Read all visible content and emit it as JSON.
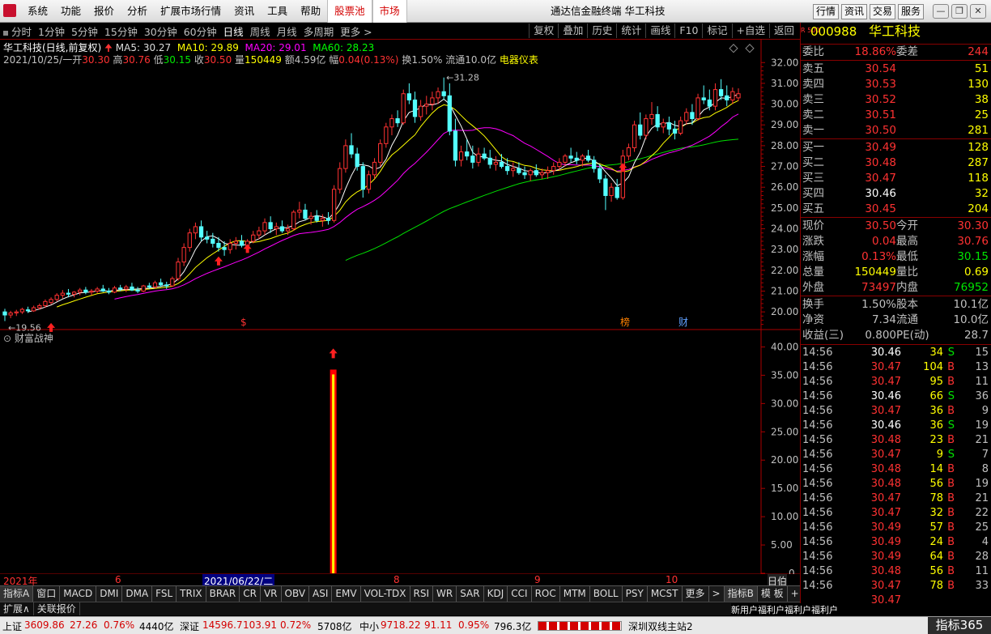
{
  "menu": {
    "items": [
      "系统",
      "功能",
      "报价",
      "分析",
      "扩展市场行情",
      "资讯",
      "工具",
      "帮助"
    ],
    "red_items": [
      "股票池",
      "市场"
    ],
    "app_title": "通达信金融终端  华工科技",
    "right_buttons": [
      "行情",
      "资讯",
      "交易",
      "服务"
    ]
  },
  "period_bar": {
    "items": [
      "分时",
      "1分钟",
      "5分钟",
      "15分钟",
      "30分钟",
      "60分钟",
      "日线",
      "周线",
      "月线",
      "多周期",
      "更多 >"
    ],
    "active": "日线",
    "tools": [
      "复权",
      "叠加",
      "历史",
      "统计",
      "画线",
      "F10",
      "标记",
      "+自选",
      "返回"
    ]
  },
  "chart_header": {
    "name": "华工科技(日线,前复权)",
    "ma5": "MA5: 30.27",
    "ma10": "MA10: 29.89",
    "ma20": "MA20: 29.01",
    "ma60": "MA60: 28.23"
  },
  "day_info": {
    "date": "2021/10/25/一",
    "open_l": "开",
    "open": "30.30",
    "high_l": "高",
    "high": "30.76",
    "low_l": "低",
    "low": "30.15",
    "close_l": "收",
    "close": "30.50",
    "vol_l": "量",
    "vol": "150449",
    "amt_l": "额",
    "amt": "4.59亿",
    "chg_l": "幅",
    "chg": "0.04(0.13%)",
    "turn": "换1.50%",
    "float": "流通10.0亿",
    "sector": "电器仪表"
  },
  "indicator": {
    "name": "财富战神"
  },
  "x_axis": {
    "labels": [
      "2021年",
      "6",
      "2021/06/22/二",
      "8",
      "9",
      "10"
    ],
    "right": "日伯"
  },
  "bottom_tabs": [
    "指标A",
    "窗口",
    "MACD",
    "DMI",
    "DMA",
    "FSL",
    "TRIX",
    "BRAR",
    "CR",
    "VR",
    "OBV",
    "ASI",
    "EMV",
    "VOL-TDX",
    "RSI",
    "WR",
    "SAR",
    "KDJ",
    "CCI",
    "ROC",
    "MTM",
    "BOLL",
    "PSY",
    "MCST",
    "更多",
    ">",
    "指标B",
    "模 板",
    "+"
  ],
  "bottom_tabs2": [
    "扩展∧",
    "关联报价"
  ],
  "status": {
    "sh_l": "上证",
    "sh": "3609.86",
    "sh_chg": "27.26",
    "sh_pct": "0.76%",
    "sh_amt": "4440亿",
    "sz_l": "深证",
    "sz": "14596.7",
    "sz_chg": "103.91",
    "sz_pct": "0.72%",
    "sz_amt": "5708亿",
    "zx_l": "中小",
    "zx": "9718.22",
    "zx_chg": "91.11",
    "zx_pct": "0.95%",
    "zx_amt": "796.3亿",
    "server": "深圳双线主站2",
    "ticker": "新用户福利户福利户福利户",
    "brand": "指标365"
  },
  "quote": {
    "tag": "R 500",
    "code": "000988",
    "name": "华工科技",
    "weibi_l": "委比",
    "weibi": "18.86%",
    "weicha_l": "委差",
    "weicha": "244",
    "asks": [
      {
        "l": "卖五",
        "p": "30.54",
        "v": "51"
      },
      {
        "l": "卖四",
        "p": "30.53",
        "v": "130"
      },
      {
        "l": "卖三",
        "p": "30.52",
        "v": "38"
      },
      {
        "l": "卖二",
        "p": "30.51",
        "v": "25"
      },
      {
        "l": "卖一",
        "p": "30.50",
        "v": "281"
      }
    ],
    "bids": [
      {
        "l": "买一",
        "p": "30.49",
        "v": "128"
      },
      {
        "l": "买二",
        "p": "30.48",
        "v": "287"
      },
      {
        "l": "买三",
        "p": "30.47",
        "v": "118"
      },
      {
        "l": "买四",
        "p": "30.46",
        "v": "32"
      },
      {
        "l": "买五",
        "p": "30.45",
        "v": "204"
      }
    ],
    "stats": [
      [
        "现价",
        "30.50",
        "今开",
        "30.30"
      ],
      [
        "涨跌",
        "0.04",
        "最高",
        "30.76"
      ],
      [
        "涨幅",
        "0.13%",
        "最低",
        "30.15"
      ],
      [
        "总量",
        "150449",
        "量比",
        "0.69"
      ],
      [
        "外盘",
        "73497",
        "内盘",
        "76952"
      ]
    ],
    "fund": [
      [
        "换手",
        "1.50%",
        "股本",
        "10.1亿"
      ],
      [
        "净资",
        "7.34",
        "流通",
        "10.0亿"
      ],
      [
        "收益(三)",
        "0.800",
        "PE(动)",
        "28.7"
      ]
    ],
    "ticks": [
      [
        "14:56",
        "30.46",
        "34",
        "S",
        "15"
      ],
      [
        "14:56",
        "30.47",
        "104",
        "B",
        "13"
      ],
      [
        "14:56",
        "30.47",
        "95",
        "B",
        "11"
      ],
      [
        "14:56",
        "30.46",
        "66",
        "S",
        "36"
      ],
      [
        "14:56",
        "30.47",
        "36",
        "B",
        "9"
      ],
      [
        "14:56",
        "30.46",
        "36",
        "S",
        "19"
      ],
      [
        "14:56",
        "30.48",
        "23",
        "B",
        "21"
      ],
      [
        "14:56",
        "30.47",
        "9",
        "S",
        "7"
      ],
      [
        "14:56",
        "30.48",
        "14",
        "B",
        "8"
      ],
      [
        "14:56",
        "30.48",
        "56",
        "B",
        "19"
      ],
      [
        "14:56",
        "30.47",
        "78",
        "B",
        "21"
      ],
      [
        "14:56",
        "30.47",
        "32",
        "B",
        "22"
      ],
      [
        "14:56",
        "30.49",
        "57",
        "B",
        "25"
      ],
      [
        "14:56",
        "30.49",
        "24",
        "B",
        "4"
      ],
      [
        "14:56",
        "30.49",
        "64",
        "B",
        "28"
      ],
      [
        "14:56",
        "30.48",
        "56",
        "B",
        "11"
      ],
      [
        "14:56",
        "30.47",
        "78",
        "B",
        "33"
      ],
      [
        "",
        "30.47",
        "",
        "",
        ""
      ]
    ]
  },
  "chart_data": {
    "type": "candlestick",
    "y_ticks": [
      "32.00",
      "31.00",
      "30.00",
      "29.00",
      "28.00",
      "27.00",
      "26.00",
      "25.00",
      "24.00",
      "23.00",
      "22.00",
      "21.00",
      "20.00"
    ],
    "sub_y_ticks": [
      "40.00",
      "35.00",
      "30.00",
      "25.00",
      "20.00",
      "15.00",
      "10.00",
      "5.00",
      "0"
    ],
    "y_range": [
      19.5,
      32.4
    ],
    "max_label": "31.28",
    "min_label": "19.56",
    "marks": [
      "$",
      "榜",
      "财"
    ],
    "signal": {
      "value": 36,
      "index": 57
    },
    "ohlc": [
      [
        20.0,
        20.15,
        19.56,
        19.85
      ],
      [
        19.85,
        20.05,
        19.7,
        19.95
      ],
      [
        19.95,
        20.1,
        19.8,
        20.0
      ],
      [
        20.0,
        20.2,
        19.9,
        20.12
      ],
      [
        20.1,
        20.25,
        19.95,
        20.05
      ],
      [
        20.05,
        20.3,
        20.0,
        20.2
      ],
      [
        20.2,
        20.4,
        20.1,
        20.3
      ],
      [
        20.3,
        20.6,
        20.2,
        20.5
      ],
      [
        20.45,
        20.7,
        20.35,
        20.6
      ],
      [
        20.6,
        20.9,
        20.5,
        20.8
      ],
      [
        20.8,
        21.05,
        20.65,
        20.9
      ],
      [
        20.9,
        21.1,
        20.7,
        20.85
      ],
      [
        20.85,
        21.0,
        20.7,
        20.95
      ],
      [
        20.95,
        21.15,
        20.8,
        21.05
      ],
      [
        21.05,
        21.2,
        20.85,
        20.95
      ],
      [
        20.95,
        21.1,
        20.8,
        21.0
      ],
      [
        21.0,
        21.2,
        20.9,
        21.1
      ],
      [
        21.1,
        21.3,
        20.95,
        21.0
      ],
      [
        21.0,
        21.15,
        20.85,
        20.95
      ],
      [
        20.95,
        21.25,
        20.9,
        21.15
      ],
      [
        21.15,
        21.3,
        21.0,
        21.1
      ],
      [
        21.1,
        21.3,
        20.95,
        21.2
      ],
      [
        21.2,
        21.4,
        21.0,
        21.05
      ],
      [
        21.05,
        21.2,
        20.9,
        21.0
      ],
      [
        21.0,
        21.3,
        20.95,
        21.25
      ],
      [
        21.25,
        21.4,
        21.1,
        21.2
      ],
      [
        21.2,
        21.5,
        21.1,
        21.4
      ],
      [
        21.4,
        21.6,
        21.2,
        21.3
      ],
      [
        21.3,
        21.45,
        21.1,
        21.25
      ],
      [
        21.25,
        21.7,
        21.2,
        21.6
      ],
      [
        21.6,
        22.6,
        21.5,
        22.4
      ],
      [
        22.4,
        23.3,
        22.2,
        23.1
      ],
      [
        23.1,
        24.0,
        22.9,
        23.8
      ],
      [
        23.8,
        24.3,
        23.5,
        24.1
      ],
      [
        24.1,
        24.4,
        23.4,
        23.6
      ],
      [
        23.6,
        23.9,
        23.3,
        23.5
      ],
      [
        23.5,
        23.8,
        23.1,
        23.3
      ],
      [
        23.3,
        23.6,
        22.9,
        23.1
      ],
      [
        23.1,
        23.4,
        22.7,
        23.0
      ],
      [
        23.0,
        23.5,
        22.8,
        23.3
      ],
      [
        23.3,
        23.6,
        23.0,
        23.4
      ],
      [
        23.4,
        23.7,
        23.1,
        23.2
      ],
      [
        23.2,
        23.5,
        22.9,
        23.4
      ],
      [
        23.4,
        23.9,
        23.3,
        23.7
      ],
      [
        23.7,
        24.1,
        23.5,
        23.9
      ],
      [
        23.9,
        24.5,
        23.7,
        24.3
      ],
      [
        24.3,
        24.6,
        23.8,
        24.0
      ],
      [
        24.0,
        24.3,
        23.7,
        24.1
      ],
      [
        24.1,
        24.4,
        23.8,
        23.9
      ],
      [
        23.9,
        24.2,
        23.7,
        24.0
      ],
      [
        24.0,
        24.9,
        23.9,
        24.8
      ],
      [
        24.8,
        25.3,
        24.5,
        24.9
      ],
      [
        24.9,
        25.2,
        24.4,
        24.5
      ],
      [
        24.5,
        24.8,
        24.2,
        24.6
      ],
      [
        24.6,
        24.9,
        24.3,
        24.4
      ],
      [
        24.4,
        24.7,
        24.1,
        24.5
      ],
      [
        24.5,
        24.8,
        24.2,
        24.4
      ],
      [
        24.4,
        26.1,
        24.3,
        25.9
      ],
      [
        25.9,
        27.2,
        25.7,
        26.9
      ],
      [
        26.9,
        28.3,
        26.7,
        28.0
      ],
      [
        28.0,
        28.6,
        27.4,
        27.6
      ],
      [
        27.6,
        27.9,
        26.8,
        27.0
      ],
      [
        27.0,
        27.2,
        25.5,
        25.9
      ],
      [
        25.9,
        26.8,
        25.7,
        26.6
      ],
      [
        26.6,
        27.4,
        26.4,
        27.2
      ],
      [
        27.2,
        28.3,
        27.0,
        28.1
      ],
      [
        28.1,
        29.1,
        27.9,
        28.9
      ],
      [
        28.9,
        29.5,
        28.5,
        29.3
      ],
      [
        29.3,
        29.7,
        28.9,
        29.1
      ],
      [
        29.1,
        30.7,
        29.0,
        30.5
      ],
      [
        30.5,
        31.0,
        30.0,
        30.2
      ],
      [
        30.2,
        30.6,
        29.1,
        29.4
      ],
      [
        29.4,
        30.2,
        29.2,
        29.9
      ],
      [
        29.9,
        30.4,
        29.5,
        30.0
      ],
      [
        30.0,
        30.6,
        29.7,
        30.3
      ],
      [
        30.3,
        30.8,
        30.0,
        30.6
      ],
      [
        30.6,
        31.28,
        30.2,
        30.4
      ],
      [
        30.4,
        31.0,
        28.5,
        28.7
      ],
      [
        28.7,
        29.3,
        27.0,
        27.3
      ],
      [
        27.3,
        28.0,
        27.0,
        27.7
      ],
      [
        27.7,
        28.3,
        27.3,
        27.5
      ],
      [
        27.5,
        28.0,
        26.9,
        27.2
      ],
      [
        27.2,
        27.9,
        27.0,
        27.6
      ],
      [
        27.6,
        27.9,
        27.3,
        27.4
      ],
      [
        27.4,
        27.8,
        26.9,
        27.1
      ],
      [
        27.1,
        27.5,
        26.8,
        27.2
      ],
      [
        27.2,
        27.6,
        26.9,
        27.0
      ],
      [
        27.0,
        27.4,
        26.6,
        26.8
      ],
      [
        26.8,
        27.2,
        26.5,
        26.9
      ],
      [
        26.9,
        27.2,
        26.6,
        26.7
      ],
      [
        26.7,
        27.0,
        26.4,
        26.6
      ],
      [
        26.6,
        26.9,
        26.3,
        26.8
      ],
      [
        26.8,
        27.1,
        26.5,
        26.6
      ],
      [
        26.6,
        26.9,
        26.4,
        26.7
      ],
      [
        26.7,
        27.0,
        26.4,
        26.8
      ],
      [
        26.8,
        27.2,
        26.6,
        27.0
      ],
      [
        27.0,
        27.4,
        26.8,
        27.2
      ],
      [
        27.2,
        27.6,
        27.0,
        27.5
      ],
      [
        27.5,
        27.9,
        27.2,
        27.4
      ],
      [
        27.4,
        27.7,
        27.1,
        27.3
      ],
      [
        27.3,
        27.6,
        27.0,
        27.5
      ],
      [
        27.5,
        27.8,
        27.2,
        27.3
      ],
      [
        27.3,
        27.5,
        26.7,
        26.9
      ],
      [
        26.9,
        27.1,
        26.2,
        26.4
      ],
      [
        26.4,
        26.6,
        24.9,
        25.6
      ],
      [
        25.6,
        26.2,
        25.3,
        26.0
      ],
      [
        26.0,
        26.4,
        25.4,
        25.5
      ],
      [
        25.5,
        27.8,
        25.4,
        27.5
      ],
      [
        27.5,
        28.1,
        27.3,
        27.9
      ],
      [
        27.9,
        29.2,
        27.7,
        29.0
      ],
      [
        29.0,
        29.6,
        28.3,
        28.5
      ],
      [
        28.5,
        29.5,
        28.3,
        29.3
      ],
      [
        29.3,
        30.1,
        29.0,
        29.5
      ],
      [
        29.5,
        29.9,
        28.7,
        28.9
      ],
      [
        28.9,
        29.3,
        28.6,
        29.1
      ],
      [
        29.1,
        29.4,
        28.5,
        28.8
      ],
      [
        28.8,
        29.2,
        28.3,
        28.6
      ],
      [
        28.6,
        29.4,
        28.5,
        29.2
      ],
      [
        29.2,
        29.8,
        29.0,
        29.6
      ],
      [
        29.6,
        30.0,
        29.0,
        29.3
      ],
      [
        29.3,
        30.5,
        29.2,
        30.3
      ],
      [
        30.3,
        30.9,
        30.0,
        30.2
      ],
      [
        30.2,
        30.7,
        29.7,
        29.9
      ],
      [
        29.9,
        31.0,
        29.7,
        30.7
      ],
      [
        30.7,
        31.2,
        30.2,
        30.4
      ],
      [
        30.4,
        30.9,
        29.9,
        30.2
      ],
      [
        30.2,
        30.8,
        30.0,
        30.6
      ],
      [
        30.3,
        30.76,
        30.15,
        30.5
      ]
    ]
  }
}
